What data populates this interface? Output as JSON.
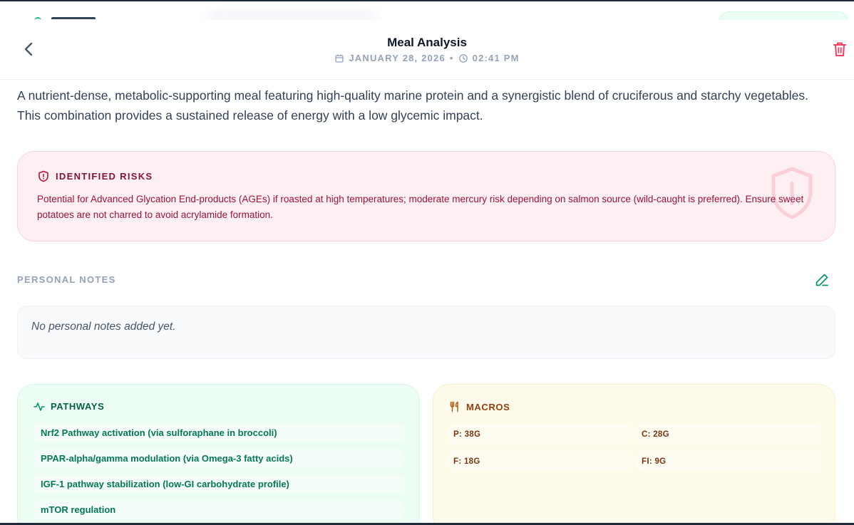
{
  "header": {
    "title": "Meal Analysis",
    "date": "JANUARY 28, 2026",
    "separator": "•",
    "time": "02:41 PM"
  },
  "summary": "A nutrient-dense, metabolic-supporting meal featuring high-quality marine protein and a synergistic blend of cruciferous and starchy vegetables. This combination provides a sustained release of energy with a low glycemic impact.",
  "risks": {
    "title": "IDENTIFIED RISKS",
    "text": "Potential for Advanced Glycation End-products (AGEs) if roasted at high temperatures; moderate mercury risk depending on salmon source (wild-caught is preferred). Ensure sweet potatoes are not charred to avoid acrylamide formation."
  },
  "notes": {
    "label": "PERSONAL NOTES",
    "placeholder": "No personal notes added yet."
  },
  "pathways": {
    "title": "PATHWAYS",
    "items": [
      "Nrf2 Pathway activation (via sulforaphane in broccoli)",
      "PPAR-alpha/gamma modulation (via Omega-3 fatty acids)",
      "IGF-1 pathway stabilization (low-GI carbohydrate profile)",
      "mTOR regulation"
    ]
  },
  "macros": {
    "title": "MACROS",
    "items": [
      "P: 38G",
      "C: 28G",
      "F: 18G",
      "FI: 9G"
    ]
  },
  "colors": {
    "accent_green": "#10b981",
    "risk_red": "#9f1239",
    "trash_red": "#f43f5e",
    "macro_brown": "#92400e"
  },
  "icons": {
    "back": "chevron-left-icon",
    "calendar": "calendar-icon",
    "clock": "clock-icon",
    "delete": "trash-icon",
    "risk": "shield-alert-icon",
    "edit": "pencil-icon",
    "pathways": "activity-icon",
    "macros": "utensils-icon"
  }
}
